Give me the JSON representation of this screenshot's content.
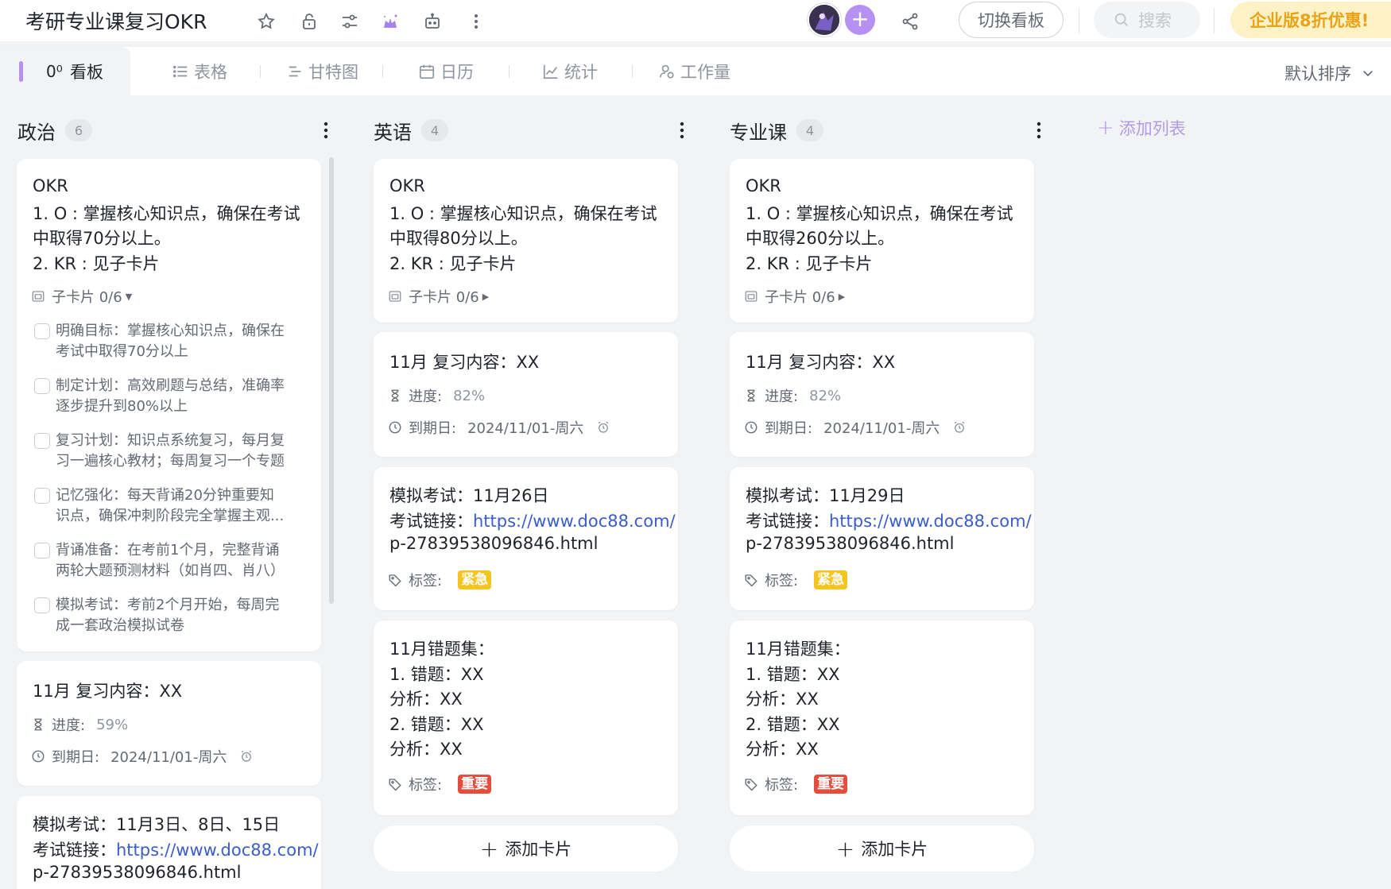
{
  "header": {
    "title": "考研专业课复习OKR",
    "switch_board": "切换看板",
    "search_placeholder": "搜索",
    "promo": "企业版8折优惠!"
  },
  "tabs": [
    {
      "label": "看板",
      "icon": "board-icon"
    },
    {
      "label": "表格",
      "icon": "list-icon"
    },
    {
      "label": "甘特图",
      "icon": "gantt-icon"
    },
    {
      "label": "日历",
      "icon": "calendar-icon"
    },
    {
      "label": "统计",
      "icon": "chart-icon"
    },
    {
      "label": "工作量",
      "icon": "workload-icon"
    }
  ],
  "sort_label": "默认排序",
  "add_list": "添加列表",
  "add_card": "添加卡片",
  "colors": {
    "accent": "#b591f2",
    "urgent": "#f6c31f",
    "important": "#e54c3c",
    "link": "#3a5ccc"
  },
  "columns": [
    {
      "title": "政治",
      "count": "6",
      "okr": {
        "lines": [
          "OKR",
          "1. O : 掌握核心知识点，确保在考试",
          "中取得70分以上。",
          "2. KR : 见子卡片"
        ],
        "subcards_label": "子卡片 0/6",
        "subcards": [
          [
            "明确目标：掌握核心知识点，确保在",
            "考试中取得70分以上"
          ],
          [
            "制定计划：高效刷题与总结，准确率",
            "逐步提升到80%以上"
          ],
          [
            "复习计划：知识点系统复习，每月复",
            "习一遍核心教材；每周复习一个专题"
          ],
          [
            "记忆强化：每天背诵20分钟重要知",
            "识点，确保冲刺阶段完全掌握主观..."
          ],
          [
            "背诵准备：在考前1个月，完整背诵",
            "两轮大题预测材料（如肖四、肖八）"
          ],
          [
            "模拟考试：考前2个月开始，每周完",
            "成一套政治模拟试卷"
          ]
        ]
      },
      "review": {
        "title": "11月 复习内容：XX",
        "progress_label": "进度:",
        "progress": "59%",
        "due_label": "到期日:",
        "due": "2024/11/01-周六"
      },
      "exam": {
        "line1": "模拟考试：11月3日、8日、15日",
        "link_label": "考试链接：",
        "link1": "https://www.doc88.com/",
        "link2": "p-27839538096846.html"
      }
    },
    {
      "title": "英语",
      "count": "4",
      "okr": {
        "lines": [
          "OKR",
          "1. O : 掌握核心知识点，确保在考试",
          "中取得80分以上。",
          "2. KR : 见子卡片"
        ],
        "subcards_label": "子卡片 0/6"
      },
      "review": {
        "title": "11月 复习内容：XX",
        "progress_label": "进度:",
        "progress": "82%",
        "due_label": "到期日:",
        "due": "2024/11/01-周六"
      },
      "exam": {
        "line1": "模拟考试：11月26日",
        "link_label": "考试链接：",
        "link1": "https://www.doc88.com/",
        "link2": "p-27839538096846.html",
        "tag_label": "标签:",
        "tag": "紧急"
      },
      "mistakes": {
        "lines": [
          "11月错题集：",
          "1. 错题：XX",
          "分析：XX",
          "2. 错题：XX",
          "分析：XX"
        ],
        "tag_label": "标签:",
        "tag": "重要"
      }
    },
    {
      "title": "专业课",
      "count": "4",
      "okr": {
        "lines": [
          "OKR",
          "1. O : 掌握核心知识点，确保在考试",
          "中取得260分以上。",
          "2. KR : 见子卡片"
        ],
        "subcards_label": "子卡片 0/6"
      },
      "review": {
        "title": "11月 复习内容：XX",
        "progress_label": "进度:",
        "progress": "82%",
        "due_label": "到期日:",
        "due": "2024/11/01-周六"
      },
      "exam": {
        "line1": "模拟考试：11月29日",
        "link_label": "考试链接：",
        "link1": "https://www.doc88.com/",
        "link2": "p-27839538096846.html",
        "tag_label": "标签:",
        "tag": "紧急"
      },
      "mistakes": {
        "lines": [
          "11月错题集：",
          "1. 错题：XX",
          "分析：XX",
          "2. 错题：XX",
          "分析：XX"
        ],
        "tag_label": "标签:",
        "tag": "重要"
      }
    }
  ]
}
